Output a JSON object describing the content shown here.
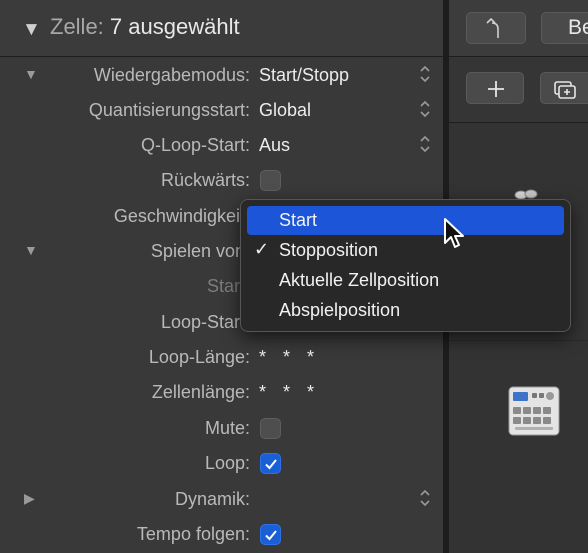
{
  "inspector": {
    "header": {
      "prefix": "Zelle:",
      "selection": "7 ausgewählt"
    },
    "rows": [
      {
        "label": "Wiedergabemodus:",
        "value": "Start/Stopp"
      },
      {
        "label": "Quantisierungsstart:",
        "value": "Global"
      },
      {
        "label": "Q-Loop-Start:",
        "value": "Aus"
      },
      {
        "label": "Rückwärts:",
        "checked": false
      },
      {
        "label": "Geschwindigkeit:"
      },
      {
        "label": "Spielen von:"
      },
      {
        "label": "Start:"
      },
      {
        "label": "Loop-Start:"
      },
      {
        "label": "Loop-Länge:",
        "value": "* * *"
      },
      {
        "label": "Zellenlänge:",
        "value": "* * *"
      },
      {
        "label": "Mute:",
        "checked": false
      },
      {
        "label": "Loop:",
        "checked": true
      },
      {
        "label": "Dynamik:",
        "value": ""
      },
      {
        "label": "Tempo folgen:",
        "checked": true
      }
    ]
  },
  "popup_menu": {
    "items": [
      {
        "label": "Start",
        "highlighted": true,
        "checked": false
      },
      {
        "label": "Stopposition",
        "highlighted": false,
        "checked": true
      },
      {
        "label": "Aktuelle Zellposition",
        "highlighted": false,
        "checked": false
      },
      {
        "label": "Abspielposition",
        "highlighted": false,
        "checked": false
      }
    ],
    "check_glyph": "✓"
  },
  "toolbar": {
    "back_icon": "curved-up-arrow-icon",
    "be_label": "Be",
    "plus_label": "+",
    "add_track_icon": "add-track-icon"
  },
  "colors": {
    "accent": "#1c55d8",
    "checkbox_on": "#1a5fd6",
    "panel_bg": "#393939",
    "menu_bg": "#282828"
  }
}
